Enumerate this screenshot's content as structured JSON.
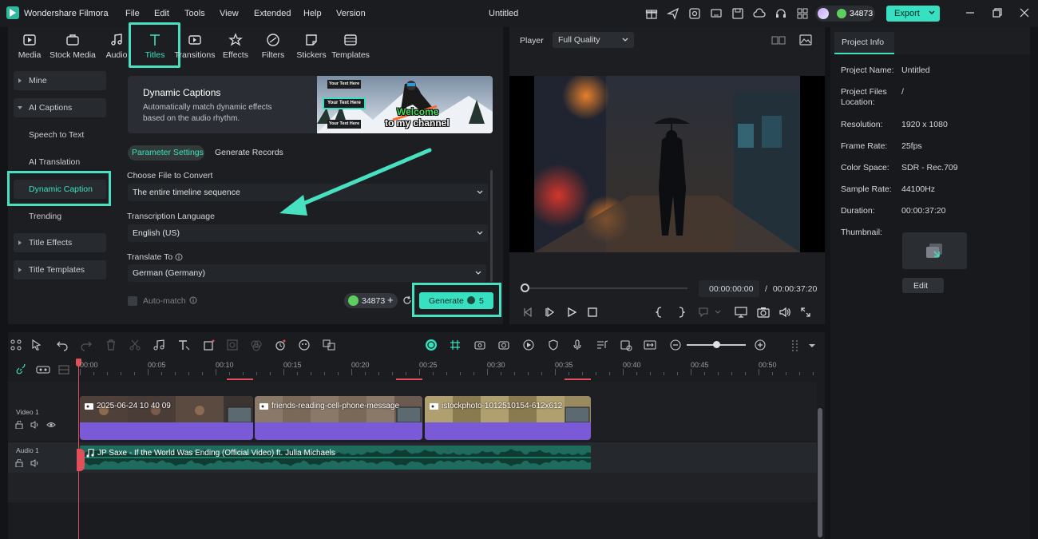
{
  "app": {
    "name": "Wondershare Filmora",
    "menu": [
      "File",
      "Edit",
      "Tools",
      "View",
      "Extended",
      "Help",
      "Version"
    ],
    "document_title": "Untitled",
    "credits": "34873",
    "export_label": "Export"
  },
  "media_tabs": [
    {
      "label": "Media",
      "icon": "media-icon"
    },
    {
      "label": "Stock Media",
      "icon": "stock-media-icon"
    },
    {
      "label": "Audio",
      "icon": "audio-icon"
    },
    {
      "label": "Titles",
      "icon": "titles-icon"
    },
    {
      "label": "Transitions",
      "icon": "transitions-icon"
    },
    {
      "label": "Effects",
      "icon": "effects-icon"
    },
    {
      "label": "Filters",
      "icon": "filters-icon"
    },
    {
      "label": "Stickers",
      "icon": "stickers-icon"
    },
    {
      "label": "Templates",
      "icon": "templates-icon"
    }
  ],
  "sidebar": {
    "items": [
      {
        "label": "Mine"
      },
      {
        "label": "AI Captions"
      },
      {
        "label": "Speech to Text"
      },
      {
        "label": "AI Translation"
      },
      {
        "label": "Dynamic Caption"
      },
      {
        "label": "Trending"
      },
      {
        "label": "Title Effects"
      },
      {
        "label": "Title Templates"
      }
    ]
  },
  "banner": {
    "title": "Dynamic Captions",
    "description": "Automatically match dynamic effects based on the audio rhythm.",
    "art_texts": [
      "Your Text Here",
      "Your Text Here",
      "Your Text Here",
      "Welcome",
      "to my channel"
    ]
  },
  "subtabs": {
    "active": "Parameter Settings",
    "other": "Generate Records"
  },
  "form": {
    "file_label": "Choose File to Convert",
    "file_value": "The entire timeline sequence",
    "language_label": "Transcription Language",
    "language_value": "English (US)",
    "translate_label": "Translate To",
    "translate_value": "German (Germany)",
    "automatch_label": "Auto-match",
    "credit_balance": "34873",
    "generate_label": "Generate",
    "generate_cost": "5"
  },
  "player": {
    "label": "Player",
    "quality": "Full Quality",
    "current_time": "00:00:00:00",
    "separator": "/",
    "total_time": "00:00:37:20",
    "progress": 0
  },
  "project_info": {
    "tab": "Project Info",
    "rows": [
      {
        "key": "Project Name:",
        "value": "Untitled"
      },
      {
        "key": "Project Files Location:",
        "value": "/"
      },
      {
        "key": "Resolution:",
        "value": "1920 x 1080"
      },
      {
        "key": "Frame Rate:",
        "value": "25fps"
      },
      {
        "key": "Color Space:",
        "value": "SDR - Rec.709"
      },
      {
        "key": "Sample Rate:",
        "value": "44100Hz"
      },
      {
        "key": "Duration:",
        "value": "00:00:37:20"
      },
      {
        "key": "Thumbnail:",
        "value": ""
      }
    ],
    "edit_label": "Edit"
  },
  "timeline": {
    "ruler": [
      "00:00",
      "00:05",
      "00:10",
      "00:15",
      "00:20",
      "00:25",
      "00:30",
      "00:35",
      "00:40",
      "00:45",
      "00:50"
    ],
    "tracks": [
      {
        "name": "Video 1"
      },
      {
        "name": "Audio 1"
      }
    ],
    "video_clips": [
      {
        "name": "2025-06-24 10 40 09"
      },
      {
        "name": "friends-reading-cell-phone-message"
      },
      {
        "name": "istockphoto-1012510154-612x612"
      }
    ],
    "audio_clip": {
      "name": "JP Saxe - If the World Was Ending (Official Video) ft. Julia Michaels"
    }
  },
  "colors": {
    "accent": "#37e0c0",
    "highlight": "#47e0c0",
    "video_clip": "#7b5ad8",
    "audio_clip": "#1f6b5d",
    "playhead": "#e0505a"
  }
}
